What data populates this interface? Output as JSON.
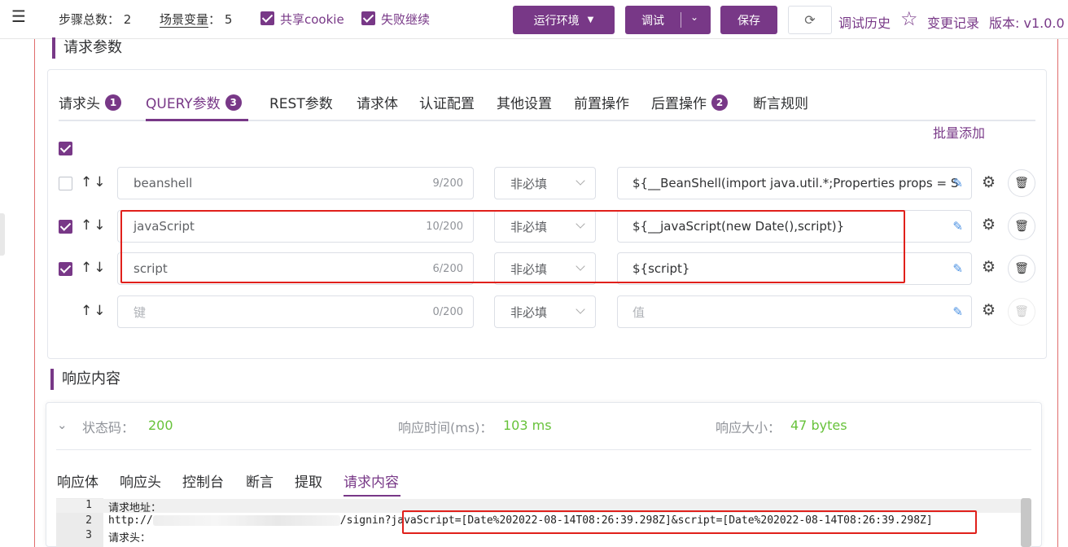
{
  "topbar": {
    "steps_label": "步骤总数：",
    "steps_value": "2",
    "vars_label": "场景变量",
    "vars_sep": "：",
    "vars_value": "5",
    "share_cookie": "共享cookie",
    "fail_continue": "失败继续",
    "env_button": "运行环境",
    "debug_button": "调试",
    "save_button": "保存",
    "debug_history": "调试历史",
    "change_log": "变更记录",
    "version": "版本: v1.0.0"
  },
  "request": {
    "title": "请求参数",
    "tabs": [
      {
        "label": "请求头",
        "badge": "1"
      },
      {
        "label": "QUERY参数",
        "badge": "3"
      },
      {
        "label": "REST参数",
        "badge": ""
      },
      {
        "label": "请求体",
        "badge": ""
      },
      {
        "label": "认证配置",
        "badge": ""
      },
      {
        "label": "其他设置",
        "badge": ""
      },
      {
        "label": "前置操作",
        "badge": ""
      },
      {
        "label": "后置操作",
        "badge": "2"
      },
      {
        "label": "断言规则",
        "badge": ""
      }
    ],
    "batch_add": "批量添加",
    "arrows": "↑↓",
    "rows": [
      {
        "checked": false,
        "key": "beanshell",
        "count": "9/200",
        "required": "非必填",
        "value": "${__BeanShell(import java.util.*;Properties props = S"
      },
      {
        "checked": true,
        "key": "javaScript",
        "count": "10/200",
        "required": "非必填",
        "value": "${__javaScript(new Date(),script)}"
      },
      {
        "checked": true,
        "key": "script",
        "count": "6/200",
        "required": "非必填",
        "value": "${script}"
      },
      {
        "checked": null,
        "key": "",
        "key_placeholder": "键",
        "count": "0/200",
        "required": "非必填",
        "value": "",
        "value_placeholder": "值"
      }
    ]
  },
  "response": {
    "title": "响应内容",
    "status_label": "状态码：",
    "status_value": "200",
    "time_label": "响应时间(ms)：",
    "time_value": "103 ms",
    "size_label": "响应大小：",
    "size_value": "47 bytes",
    "tabs": [
      "响应体",
      "响应头",
      "控制台",
      "断言",
      "提取",
      "请求内容"
    ],
    "code_lines": [
      {
        "n": "1",
        "text": "请求地址："
      },
      {
        "n": "2",
        "prefix": "http://",
        "suffix": "/signin?",
        "highlight": "javaScript=[Date%202022-08-14T08:26:39.298Z]&script=[Date%202022-08-14T08:26:39.298Z]"
      },
      {
        "n": "3",
        "text": "请求头："
      }
    ]
  },
  "colors": {
    "accent": "#783887",
    "success": "#67c23a",
    "highlight_box": "#e0201b"
  }
}
